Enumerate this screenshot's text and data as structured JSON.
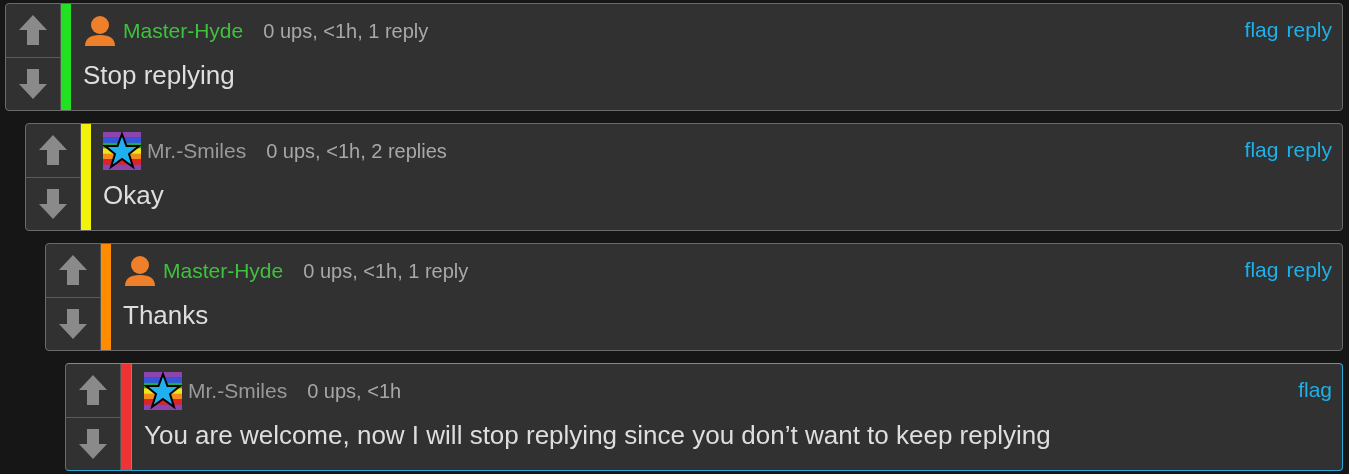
{
  "comments": [
    {
      "author": "Master-Hyde",
      "kind": "person",
      "meta": "0 ups, <1h, 1 reply",
      "text": "Stop replying",
      "color": "#22e022",
      "highlighted": false,
      "actions": [
        "flag",
        "reply"
      ],
      "children": [
        {
          "author": "Mr.-Smiles",
          "kind": "star",
          "meta": "0 ups, <1h, 2 replies",
          "text": "Okay",
          "color": "#f2f20a",
          "highlighted": false,
          "actions": [
            "flag",
            "reply"
          ],
          "children": [
            {
              "author": "Master-Hyde",
              "kind": "person",
              "meta": "0 ups, <1h, 1 reply",
              "text": "Thanks",
              "color": "#ff8c00",
              "highlighted": false,
              "actions": [
                "flag",
                "reply"
              ],
              "children": [
                {
                  "author": "Mr.-Smiles",
                  "kind": "star",
                  "meta": "0 ups, <1h",
                  "text": "You are welcome, now I will stop replying since you don’t want to keep replying",
                  "color": "#ee3333",
                  "highlighted": true,
                  "actions": [
                    "flag"
                  ]
                }
              ]
            }
          ]
        }
      ]
    }
  ]
}
